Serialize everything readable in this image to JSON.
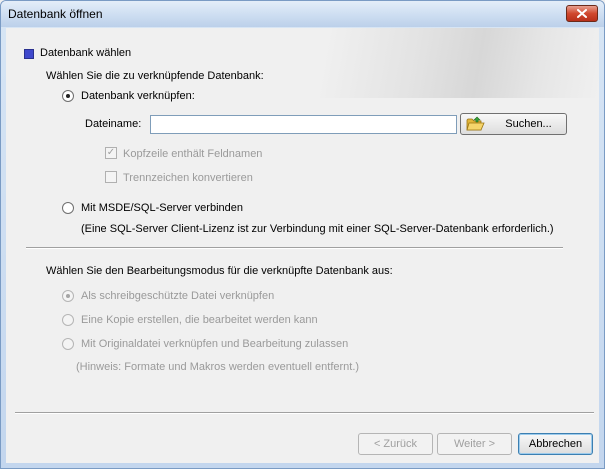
{
  "window": {
    "title": "Datenbank öffnen"
  },
  "section": {
    "heading": "Datenbank wählen",
    "choose_db_label": "Wählen Sie die zu verknüpfende Datenbank:"
  },
  "link_db": {
    "radio_label": "Datenbank verknüpfen:",
    "selected": true,
    "filename_label": "Dateiname:",
    "filename_value": "",
    "browse_button": "Suchen...",
    "header_checkbox_label": "Kopfzeile enthält Feldnamen",
    "header_checked": true,
    "convert_checkbox_label": "Trennzeichen konvertieren",
    "convert_checked": false
  },
  "msde": {
    "radio_label": "Mit MSDE/SQL-Server verbinden",
    "selected": false,
    "note": "(Eine SQL-Server Client-Lizenz ist zur Verbindung mit einer SQL-Server-Datenbank erforderlich.)"
  },
  "edit_mode": {
    "heading": "Wählen Sie den Bearbeitungsmodus für die verknüpfte Datenbank aus:",
    "options": [
      {
        "label": "Als schreibgeschützte Datei verknüpfen",
        "selected": true
      },
      {
        "label": "Eine Kopie erstellen, die bearbeitet werden kann",
        "selected": false
      },
      {
        "label": "Mit Originaldatei verknüpfen und Bearbeitung zulassen",
        "selected": false
      }
    ],
    "hint": "(Hinweis: Formate und Makros werden eventuell entfernt.)"
  },
  "footer": {
    "back_button": "< Zurück",
    "next_button": "Weiter >",
    "cancel_button": "Abbrechen"
  },
  "colors": {
    "accent_square": "#3f48cc",
    "close_button": "#d0482e",
    "disabled_text": "#9a9a9a"
  }
}
